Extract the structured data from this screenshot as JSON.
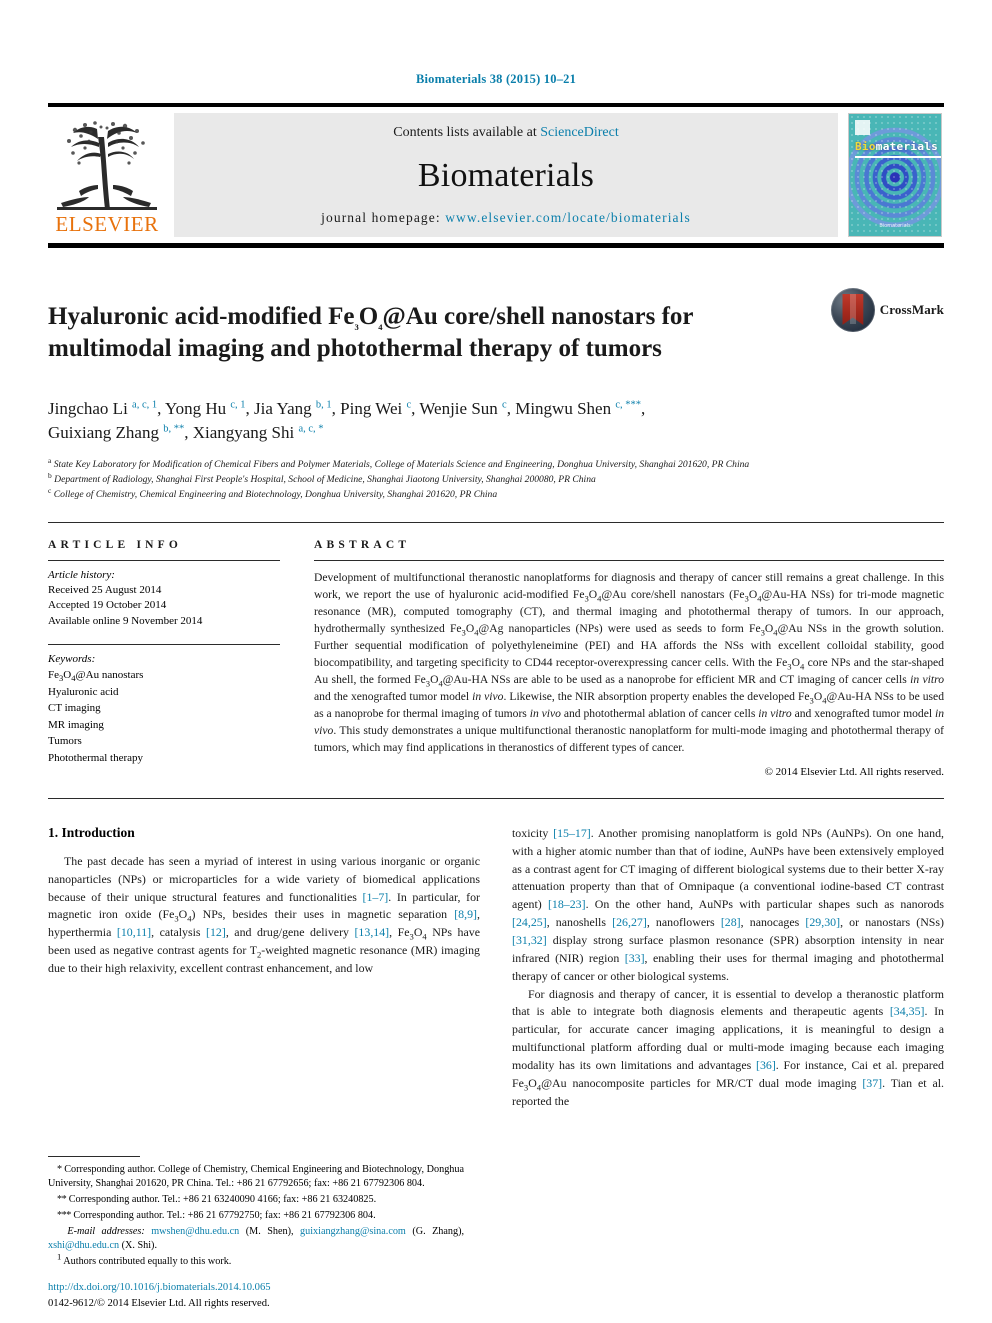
{
  "running_head": "Biomaterials 38 (2015) 10–21",
  "masthead": {
    "publisher_name": "ELSEVIER",
    "contents_prefix": "Contents lists available at ",
    "contents_link": "ScienceDirect",
    "journal_name": "Biomaterials",
    "homepage_prefix": "journal homepage: ",
    "homepage_url": "www.elsevier.com/locate/biomaterials",
    "cover_title_bio": "Bio",
    "cover_title_rest": "materials",
    "cover_footer": "Biomaterials"
  },
  "article": {
    "title_line1": "Hyaluronic acid-modified Fe3O4@Au core/shell nanostars for",
    "title_line2": "multimodal imaging and photothermal therapy of tumors",
    "crossmark_label": "CrossMark",
    "authors_line1": "Jingchao Li a, c, 1, Yong Hu c, 1, Jia Yang b, 1, Ping Wei c, Wenjie Sun c, Mingwu Shen c, ***,",
    "authors_line2": "Guixiang Zhang b, **, Xiangyang Shi a, c, *",
    "affiliation_a": "State Key Laboratory for Modification of Chemical Fibers and Polymer Materials, College of Materials Science and Engineering, Donghua University, Shanghai 201620, PR China",
    "affiliation_b": "Department of Radiology, Shanghai First People's Hospital, School of Medicine, Shanghai Jiaotong University, Shanghai 200080, PR China",
    "affiliation_c": "College of Chemistry, Chemical Engineering and Biotechnology, Donghua University, Shanghai 201620, PR China"
  },
  "article_info": {
    "heading": "ARTICLE INFO",
    "history_label": "Article history:",
    "received": "Received 25 August 2014",
    "accepted": "Accepted 19 October 2014",
    "available": "Available online 9 November 2014",
    "keywords_label": "Keywords:",
    "keywords": [
      "Fe3O4@Au nanostars",
      "Hyaluronic acid",
      "CT imaging",
      "MR imaging",
      "Tumors",
      "Photothermal therapy"
    ]
  },
  "abstract": {
    "heading": "ABSTRACT",
    "copyright": "© 2014 Elsevier Ltd. All rights reserved."
  },
  "introduction": {
    "section_title": "1. Introduction"
  },
  "footnotes": {
    "f1": "Corresponding author. College of Chemistry, Chemical Engineering and Biotechnology, Donghua University, Shanghai 201620, PR China. Tel.: +86 21 67792656; fax: +86 21 67792306 804.",
    "f2": "Corresponding author. Tel.: +86 21 63240090 4166; fax: +86 21 63240825.",
    "f3": "Corresponding author. Tel.: +86 21 67792750; fax: +86 21 67792306 804.",
    "email_label": "E-mail addresses:",
    "email1": "mwshen@dhu.edu.cn",
    "email1_who": "(M. Shen),",
    "email2": "guixiangzhang@sina.com",
    "email2_who": "(G. Zhang),",
    "email3": "xshi@dhu.edu.cn",
    "email3_who": "(X. Shi).",
    "f4": "Authors contributed equally to this work."
  },
  "doi": {
    "url": "http://dx.doi.org/10.1016/j.biomaterials.2014.10.065",
    "issn_line": "0142-9612/© 2014 Elsevier Ltd. All rights reserved."
  },
  "colors": {
    "link": "#0b7fab",
    "elsevier_orange": "#e8720c",
    "cover_teal": "#49b6b6",
    "crossmark_red": "#a3281c"
  }
}
